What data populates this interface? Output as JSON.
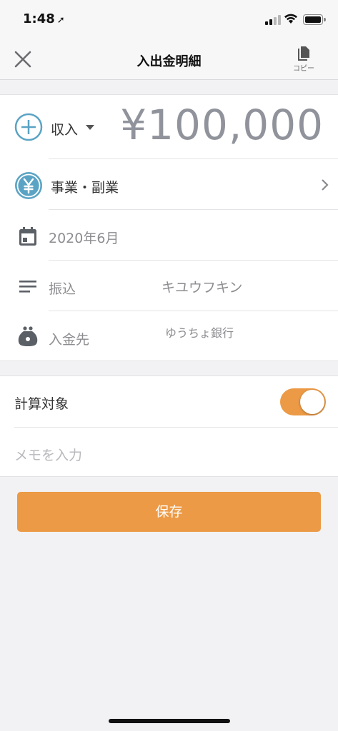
{
  "status_bar": {
    "time": "1:48",
    "location_glyph": "➚"
  },
  "nav": {
    "title": "入出金明細",
    "copy_label": "コピー",
    "close_icon": "close-icon",
    "copy_icon": "copy-icon"
  },
  "entry": {
    "type_label": "収入",
    "amount": "¥100,000",
    "category": "事業・副業",
    "date": "2020年6月",
    "memo_key": "振込",
    "memo_value": "キユウフキン",
    "account_key": "入金先",
    "account_value": "ゆうちょ銀行"
  },
  "options": {
    "calc_label": "計算対象",
    "calc_enabled": true,
    "memo_placeholder": "メモを入力"
  },
  "save_label": "保存",
  "colors": {
    "accent": "#ec9a45",
    "icon_blue": "#5aa3c4",
    "amount_gray": "#90939b"
  }
}
